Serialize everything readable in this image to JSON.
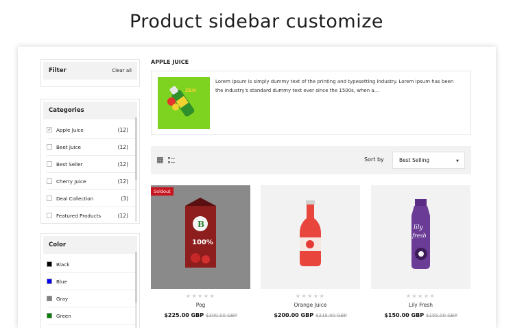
{
  "headline": "Product sidebar customize",
  "filter": {
    "title": "Filter",
    "clear_label": "Clear all"
  },
  "categories": {
    "title": "Categories",
    "items": [
      {
        "label": "Apple Juice",
        "count": "(12)",
        "checked": "✔"
      },
      {
        "label": "Beet Juice",
        "count": "(12)"
      },
      {
        "label": "Best Seller",
        "count": "(12)"
      },
      {
        "label": "Cherry Juice",
        "count": "(12)"
      },
      {
        "label": "Deal Collection",
        "count": "(3)"
      },
      {
        "label": "Featured Products",
        "count": "(12)"
      }
    ]
  },
  "color_filter": {
    "title": "Color",
    "items": [
      {
        "label": "Black",
        "swatch": "#000000"
      },
      {
        "label": "Blue",
        "swatch": "#0000ff"
      },
      {
        "label": "Gray",
        "swatch": "#808080"
      },
      {
        "label": "Green",
        "swatch": "#008000"
      }
    ]
  },
  "main": {
    "category_title": "APPLE JUICE",
    "category_description": "Lorem Ipsum is simply dummy text of the printing and typesetting industry. Lorem Ipsum has been the industry's standard dummy text ever since the 1500s, when a...",
    "sort_label": "Sort by",
    "sort_value": "Best Selling",
    "view_icons": [
      "grid-view-icon",
      "list-view-icon"
    ]
  },
  "products": [
    {
      "name": "Pog",
      "price": "$225.00 GBP",
      "old_price": "$300.00 GBP",
      "badge": "Soldout",
      "rating": "★★★★★"
    },
    {
      "name": "Orange Juice",
      "price": "$200.00 GBP",
      "old_price": "$215.00 GBP",
      "rating": "★★★★★"
    },
    {
      "name": "Lily Fresh",
      "price": "$150.00 GBP",
      "old_price": "$155.00 GBP",
      "rating": "★★★★★"
    }
  ],
  "colors": {
    "soldout_badge": "#c8141e",
    "category_image_bg": "#7ed321"
  }
}
